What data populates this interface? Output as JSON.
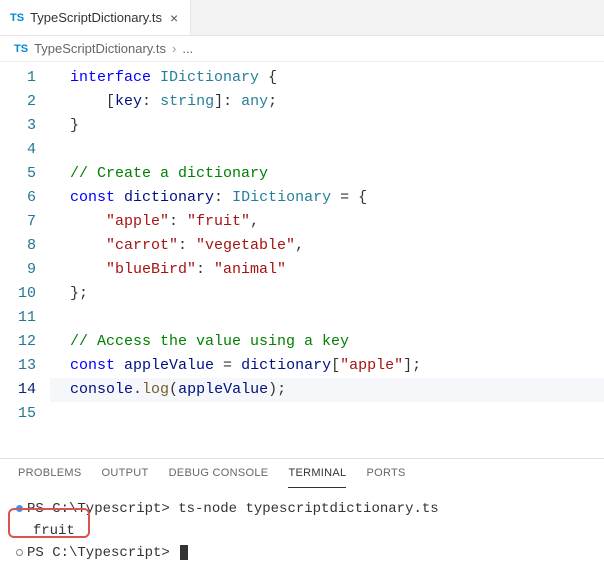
{
  "tab": {
    "badge": "TS",
    "title": "TypeScriptDictionary.ts",
    "close": "×"
  },
  "breadcrumb": {
    "badge": "TS",
    "file": "TypeScriptDictionary.ts",
    "separator": "›",
    "more": "..."
  },
  "editor": {
    "lines": {
      "l1": {
        "num": "1",
        "kw": "interface",
        "type": "IDictionary",
        "brace": " {"
      },
      "l2": {
        "num": "2",
        "text_open": "[",
        "ident": "key",
        "colon": ": ",
        "t1": "string",
        "close": "]: ",
        "t2": "any",
        "semi": ";"
      },
      "l3": {
        "num": "3",
        "brace": "}"
      },
      "l4": {
        "num": "4"
      },
      "l5": {
        "num": "5",
        "comment": "// Create a dictionary"
      },
      "l6": {
        "num": "6",
        "kw": "const",
        "ident": " dictionary",
        "colon": ": ",
        "type": "IDictionary",
        "eq": " = {"
      },
      "l7": {
        "num": "7",
        "k": "\"apple\"",
        "sep": ": ",
        "v": "\"fruit\"",
        "comma": ","
      },
      "l8": {
        "num": "8",
        "k": "\"carrot\"",
        "sep": ": ",
        "v": "\"vegetable\"",
        "comma": ","
      },
      "l9": {
        "num": "9",
        "k": "\"blueBird\"",
        "sep": ": ",
        "v": "\"animal\""
      },
      "l10": {
        "num": "10",
        "brace": "};"
      },
      "l11": {
        "num": "11"
      },
      "l12": {
        "num": "12",
        "comment": "// Access the value using a key"
      },
      "l13": {
        "num": "13",
        "kw": "const",
        "ident": " appleValue",
        "eq": " = ",
        "dict": "dictionary",
        "open": "[",
        "key": "\"apple\"",
        "close": "];"
      },
      "l14": {
        "num": "14",
        "obj": "console",
        "dot": ".",
        "fn": "log",
        "open": "(",
        "arg": "appleValue",
        "close": ");"
      },
      "l15": {
        "num": "15"
      }
    }
  },
  "panel": {
    "tabs": {
      "problems": "PROBLEMS",
      "output": "OUTPUT",
      "debug": "DEBUG CONSOLE",
      "terminal": "TERMINAL",
      "ports": "PORTS"
    }
  },
  "terminal": {
    "prompt1_path": "PS C:\\Typescript>",
    "cmd": " ts-node typescriptdictionary.ts",
    "output1": "fruit",
    "prompt2_path": "PS C:\\Typescript>"
  }
}
